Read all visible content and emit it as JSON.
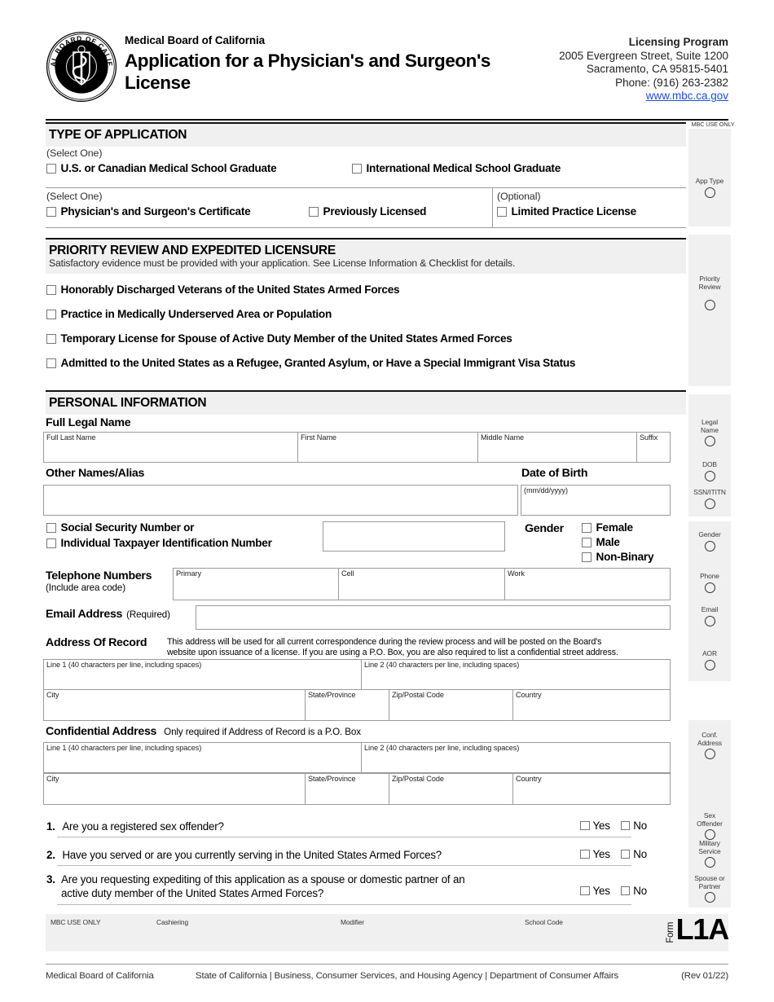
{
  "header": {
    "org_name": "Medical Board of California",
    "doc_title": "Application for a Physician's and Surgeon's License",
    "program": "Licensing Program",
    "address_line1": "2005 Evergreen Street, Suite 1200",
    "address_line2": "Sacramento, CA 95815-5401",
    "phone": "Phone: (916) 263-2382",
    "website": "www.mbc.ca.gov",
    "logo_alt": "Medical Board of California seal, EST 1876"
  },
  "sidebar": {
    "title": "MBC USE ONLY",
    "items": [
      {
        "label": "App Type"
      },
      {
        "label": "Priority\nReview"
      },
      {
        "label": "Legal\nName"
      },
      {
        "label": "DOB"
      },
      {
        "label": "SSN/ITITN"
      },
      {
        "label": "Gender"
      },
      {
        "label": "Phone"
      },
      {
        "label": "Email"
      },
      {
        "label": "AOR"
      },
      {
        "label": "Conf.\nAddress"
      },
      {
        "label": "Sex\nOffender"
      },
      {
        "label": "Military\nService"
      },
      {
        "label": "Spouse or\nPartner"
      }
    ]
  },
  "type_of_application": {
    "heading": "TYPE OF APPLICATION",
    "select_one_1": "(Select One)",
    "row1": [
      {
        "label": "U.S. or Canadian Medical School Graduate",
        "checked": false
      },
      {
        "label": "International Medical School Graduate",
        "checked": false
      }
    ],
    "select_one_2": "(Select One)",
    "optional_note": "(Optional)",
    "row2": [
      {
        "label": "Physician's and Surgeon's Certificate",
        "checked": false
      },
      {
        "label": "Previously Licensed",
        "checked": false
      }
    ],
    "row2_optional": [
      {
        "label": "Limited Practice License",
        "checked": false
      }
    ]
  },
  "priority_review": {
    "heading": "PRIORITY REVIEW AND EXPEDITED LICENSURE",
    "subtext": "Satisfactory evidence must be provided with your application. See License Information & Checklist for details.",
    "options": [
      {
        "label": "Honorably Discharged Veterans of the United States Armed Forces",
        "checked": false
      },
      {
        "label": "Practice in Medically Underserved Area or Population",
        "checked": false
      },
      {
        "label": "Temporary License for Spouse of Active Duty Member of the United States Armed Forces",
        "checked": false
      },
      {
        "label": "Admitted to the United States as a Refugee, Granted Asylum, or Have a Special Immigrant Visa Status",
        "checked": false
      }
    ]
  },
  "personal_information": {
    "heading": "PERSONAL INFORMATION",
    "full_legal_name": {
      "label": "Full Legal Name",
      "fields": [
        {
          "caption": "Full Last Name",
          "value": ""
        },
        {
          "caption": "First Name",
          "value": ""
        },
        {
          "caption": "Middle Name",
          "value": ""
        },
        {
          "caption": "Suffix",
          "value": ""
        }
      ]
    },
    "other_names": {
      "label": "Other Names/Alias",
      "value": ""
    },
    "date_of_birth": {
      "label": "Date of Birth",
      "caption": "(mm/dd/yyyy)",
      "value": ""
    },
    "ssn": {
      "line1": "Social Security Number or",
      "line2": "Individual Taxpayer Identification Number",
      "checked1": false,
      "checked2": false,
      "value": ""
    },
    "gender": {
      "label": "Gender",
      "options": [
        {
          "label": "Female",
          "checked": false
        },
        {
          "label": "Male",
          "checked": false
        },
        {
          "label": "Non-Binary",
          "checked": false
        }
      ]
    },
    "telephone": {
      "label": "Telephone Numbers",
      "sublabel": "(Include area code)",
      "fields": [
        {
          "caption": "Primary",
          "value": ""
        },
        {
          "caption": "Cell",
          "value": ""
        },
        {
          "caption": "Work",
          "value": ""
        }
      ]
    },
    "email": {
      "label": "Email Address",
      "sublabel": "(Required)",
      "value": ""
    },
    "address_of_record": {
      "label": "Address Of Record",
      "note_line1": "This address will be used for all current correspondence during the review process and will be posted on the Board's",
      "note_line2": "website upon issuance of a license. If you are using a P.O. Box, you are also required to list a confidential street address.",
      "fields": [
        {
          "caption": "Line 1 (40 characters per line, including spaces)",
          "value": ""
        },
        {
          "caption": "Line 2 (40 characters per line, including spaces)",
          "value": ""
        },
        {
          "caption": "City",
          "value": ""
        },
        {
          "caption": "State/Province",
          "value": ""
        },
        {
          "caption": "Zip/Postal Code",
          "value": ""
        },
        {
          "caption": "Country",
          "value": ""
        }
      ]
    },
    "confidential_address": {
      "label": "Confidential Address",
      "note": "Only required if Address of Record is a P.O. Box",
      "fields": [
        {
          "caption": "Line 1 (40 characters per line, including spaces)",
          "value": ""
        },
        {
          "caption": "Line 2 (40 characters per line, including spaces)",
          "value": ""
        },
        {
          "caption": "City",
          "value": ""
        },
        {
          "caption": "State/Province",
          "value": ""
        },
        {
          "caption": "Zip/Postal Code",
          "value": ""
        },
        {
          "caption": "Country",
          "value": ""
        }
      ]
    }
  },
  "questions": {
    "yes_label": "Yes",
    "no_label": "No",
    "items": [
      {
        "number": "1.",
        "line1": "Are you a registered sex offender?",
        "line2": "",
        "yes": false,
        "no": false
      },
      {
        "number": "2.",
        "line1": "Have you served or are you currently serving in the United States Armed Forces?",
        "line2": "",
        "yes": false,
        "no": false
      },
      {
        "number": "3.",
        "line1": "Are you requesting expediting of this application as a spouse or domestic partner of an",
        "line2": "active duty member of the United States Armed Forces?",
        "yes": false,
        "no": false
      }
    ]
  },
  "footer_box": {
    "mbc_use_only": "MBC USE ONLY",
    "cashiering": "Cashiering",
    "modifier": "Modifier",
    "school_code": "School Code",
    "form_word": "Form",
    "form_code": "L1A"
  },
  "footer": {
    "left": "Medical Board of California",
    "center": "State of California | Business, Consumer Services, and Housing Agency | Department of Consumer Affairs",
    "right": "(Rev 01/22)"
  }
}
